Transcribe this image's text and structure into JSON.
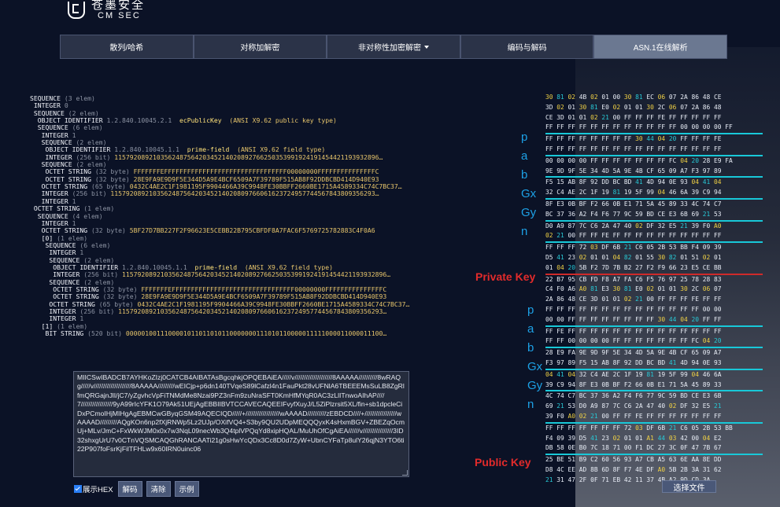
{
  "logo": {
    "cn": "苍墨安全",
    "en": "CM  SEC"
  },
  "nav": [
    {
      "label": "散列/哈希",
      "active": false
    },
    {
      "label": "对称加解密",
      "active": false
    },
    {
      "label": "非对称性加密解密",
      "active": false,
      "dropdown": true
    },
    {
      "label": "编码与解码",
      "active": false
    },
    {
      "label": "ASN.1在线解析",
      "active": true
    }
  ],
  "tree": [
    [
      [
        "k",
        "SEQUENCE"
      ],
      [
        "t",
        " (3 elem)"
      ]
    ],
    [
      [
        "k",
        " INTEGER"
      ],
      [
        "t",
        " 0"
      ]
    ],
    [
      [
        "k",
        " SEQUENCE"
      ],
      [
        "t",
        " (2 elem)"
      ]
    ],
    [
      [
        "k",
        "  OBJECT IDENTIFIER"
      ],
      [
        "t",
        " 1.2.840.10045.2.1"
      ],
      [
        "o",
        "  ecPublicKey"
      ],
      [
        "v",
        "  (ANSI X9.62 public key type)"
      ]
    ],
    [
      [
        "k",
        "  SEQUENCE"
      ],
      [
        "t",
        " (6 elem)"
      ]
    ],
    [
      [
        "k",
        "   INTEGER"
      ],
      [
        "t",
        " 1"
      ]
    ],
    [
      [
        "k",
        "   SEQUENCE"
      ],
      [
        "t",
        " (2 elem)"
      ]
    ],
    [
      [
        "k",
        "    OBJECT IDENTIFIER"
      ],
      [
        "t",
        " 1.2.840.10045.1.1"
      ],
      [
        "o",
        "  prime-field"
      ],
      [
        "v",
        "  (ANSI X9.62 field type)"
      ]
    ],
    [
      [
        "k",
        "    INTEGER"
      ],
      [
        "t",
        " (256 bit)"
      ],
      [
        "v",
        " 115792089210356248756420345214020892766250353991924191454421193932896…"
      ]
    ],
    [
      [
        "k",
        "   SEQUENCE"
      ],
      [
        "t",
        " (2 elem)"
      ]
    ],
    [
      [
        "k",
        "    OCTET STRING"
      ],
      [
        "t",
        " (32 byte)"
      ],
      [
        "v",
        " FFFFFFFEFFFFFFFFFFFFFFFFFFFFFFFFFFFFFFFF00000000FFFFFFFFFFFFFFFC"
      ]
    ],
    [
      [
        "k",
        "    OCTET STRING"
      ],
      [
        "t",
        " (32 byte)"
      ],
      [
        "v",
        " 28E9FA9E9D9F5E344D5A9E4BCF6509A7F39789F515AB8F92DDBCBD414D940E93"
      ]
    ],
    [
      [
        "k",
        "   OCTET STRING"
      ],
      [
        "t",
        " (65 byte)"
      ],
      [
        "v",
        " 0432C4AE2C1F1981195F9904466A39C9948FE30BBFF2660BE1715A4589334C74C7BC37…"
      ]
    ],
    [
      [
        "k",
        "   INTEGER"
      ],
      [
        "t",
        " (256 bit)"
      ],
      [
        "v",
        " 115792089210356248756420345214020809766061623724957744567843809356293…"
      ]
    ],
    [
      [
        "k",
        "   INTEGER"
      ],
      [
        "t",
        " 1"
      ]
    ],
    [
      [
        "k",
        " OCTET STRING"
      ],
      [
        "t",
        " (1 elem)"
      ]
    ],
    [
      [
        "k",
        "  SEQUENCE"
      ],
      [
        "t",
        " (4 elem)"
      ]
    ],
    [
      [
        "k",
        "   INTEGER"
      ],
      [
        "t",
        " 1"
      ]
    ],
    [
      [
        "k",
        "   OCTET STRING"
      ],
      [
        "t",
        " (32 byte)"
      ],
      [
        "v",
        " 5BF27D7BB227F2F96623E5CEBB22B795CBFDF8A7FAC6F5769725782883C4F0A6"
      ]
    ],
    [
      [
        "k",
        "   [0]"
      ],
      [
        "t",
        " (1 elem)"
      ]
    ],
    [
      [
        "k",
        "    SEQUENCE"
      ],
      [
        "t",
        " (6 elem)"
      ]
    ],
    [
      [
        "k",
        "     INTEGER"
      ],
      [
        "t",
        " 1"
      ]
    ],
    [
      [
        "k",
        "     SEQUENCE"
      ],
      [
        "t",
        " (2 elem)"
      ]
    ],
    [
      [
        "k",
        "      OBJECT IDENTIFIER"
      ],
      [
        "t",
        " 1.2.840.10045.1.1"
      ],
      [
        "o",
        "  prime-field"
      ],
      [
        "v",
        "  (ANSI X9.62 field type)"
      ]
    ],
    [
      [
        "k",
        "      INTEGER"
      ],
      [
        "t",
        " (256 bit)"
      ],
      [
        "v",
        " 115792089210356248756420345214020892766250353991924191454421193932896…"
      ]
    ],
    [
      [
        "k",
        "     SEQUENCE"
      ],
      [
        "t",
        " (2 elem)"
      ]
    ],
    [
      [
        "k",
        "      OCTET STRING"
      ],
      [
        "t",
        " (32 byte)"
      ],
      [
        "v",
        " FFFFFFFEFFFFFFFFFFFFFFFFFFFFFFFFFFFFFFFF00000000FFFFFFFFFFFFFFFC"
      ]
    ],
    [
      [
        "k",
        "      OCTET STRING"
      ],
      [
        "t",
        " (32 byte)"
      ],
      [
        "v",
        " 28E9FA9E9D9F5E344D5A9E4BCF6509A7F39789F515AB8F92DDBCBD414D940E93"
      ]
    ],
    [
      [
        "k",
        "     OCTET STRING"
      ],
      [
        "t",
        " (65 byte)"
      ],
      [
        "v",
        " 0432C4AE2C1F1981195F9904466A39C9948FE30BBFF2660BE1715A4589334C74C7BC37…"
      ]
    ],
    [
      [
        "k",
        "     INTEGER"
      ],
      [
        "t",
        " (256 bit)"
      ],
      [
        "v",
        " 115792089210356248756420345214020809766061623724957744567843809356293…"
      ]
    ],
    [
      [
        "k",
        "     INTEGER"
      ],
      [
        "t",
        " 1"
      ]
    ],
    [
      [
        "k",
        "   [1]"
      ],
      [
        "t",
        " (1 elem)"
      ]
    ],
    [
      [
        "k",
        "    BIT STRING"
      ],
      [
        "t",
        " (520 bit)"
      ],
      [
        "v",
        " 0000010011100001011011010110000000111010110000011111000011000011100…"
      ]
    ]
  ],
  "labels": {
    "params_top": [
      "p",
      "a",
      "b",
      "Gx",
      "Gy",
      "n"
    ],
    "params_bottom": [
      "p",
      "a",
      "b",
      "Gx",
      "Gy",
      "n"
    ],
    "private_key": "Private Key",
    "public_key": "Public Key"
  },
  "hex_lines": [
    "30 81 02 4B 02 01 00 30 81 EC 06 07 2A 86 48 CE",
    "3D 02 01 30 81 E0 02 01 01 30 2C 06 07 2A 86 48",
    "CE 3D 01 01 02 21 00 FF FF FF FE FF FF FF FF FF",
    "FF FF FF FF FF FF FF FF FF FF FF FF 00 00 00 00 FF",
    "FF FF FF FF FF FF FF FF 30 44 04 20 FF FF FF FE",
    "FF FF FF FF FF FF FF FF FF FF FF FF FF FF FF FF",
    "00 00 00 00 FF FF FF FF FF FF FF FC 04 20 28 E9 FA",
    "9E 9D 9F 5E 34 4D 5A 9E 4B CF 65 09 A7 F3 97 89",
    "F5 15 AB 8F 92 DD BC BD 41 4D 94 0E 93 04 41 04",
    "32 C4 AE 2C 1F 19 81 19 5F 99 04 46 6A 39 C9 94",
    "8F E3 0B BF F2 66 0B E1 71 5A 45 89 33 4C 74 C7",
    "BC 37 36 A2 F4 F6 77 9C 59 BD CE E3 6B 69 21 53",
    "D0 A9 87 7C C6 2A 47 40 02 DF 32 E5 21 39 F0 A0",
    "02 21 00 FF FF FE FF FF FF FF FF FF FF FF FF FF",
    "FF FF FF 72 03 DF 6B 21 C6 05 2B 53 BB F4 09 39",
    "D5 41 23 02 01 01 04 82 01 55 30 82 01 51 02 01",
    "01 04 20 5B F2 7D 7B B2 27 F2 F9 66 23 E5 CE BB",
    "22 B7 95 CB FD F8 A7 FA C6 F5 76 97 25 78 28 83",
    "C4 F0 A6 A0 81 E3 30 81 E0 02 01 01 30 2C 06 07",
    "2A 86 48 CE 3D 01 01 02 21 00 FF FF FF FE FF FF",
    "FF FF FF FF FF FF FF FF FF FF FF FF FF FF 00 00",
    "00 00 FF FF FF FF FF FF FF FF 30 44 04 20 FF FF",
    "FF FE FF FF FF FF FF FF FF FF FF FF FF FF FF FF",
    "FF FF 00 00 00 00 FF FF FF FF FF FF FF FC 04 20",
    "28 E9 FA 9E 9D 9F 5E 34 4D 5A 9E 4B CF 65 09 A7",
    "F3 97 89 F5 15 AB 8F 92 DD BC BD 41 4D 94 0E 93",
    "04 41 04 32 C4 AE 2C 1F 19 81 19 5F 99 04 46 6A",
    "39 C9 94 8F E3 0B BF F2 66 0B E1 71 5A 45 89 33",
    "4C 74 C7 BC 37 36 A2 F4 F6 77 9C 59 BD CE E3 6B",
    "69 21 53 D0 A9 87 7C C6 2A 47 40 02 DF 32 E5 21",
    "39 F0 A0 02 21 00 FF FF FE FF FF FF FF FF FF FF",
    "FF FF FF FF FF FF FF 72 03 DF 6B 21 C6 05 2B 53 BB",
    "F4 09 39 D5 41 23 02 01 01 A1 44 03 42 00 04 E2",
    "DB 58 0E B0 7C 18 71 00 F1 DC 27 3C 0F 47 7B 67",
    "25 BE 51 B9 C2 60 56 93 A7 CB A5 63 6E AA 8E DD",
    "D8 4C EE AD 8B 6D 8F F7 4E DF A0 5B 2B 3A 31 62",
    "21 31 47 2F 0F 71 EB 42 11 37 4B A2 9D CD 3A"
  ],
  "textarea": {
    "value": "MIICSwIBADCB7AYHKoZIzj0CATCB4AIBATAsBgcqhkjOPQEBAiEA/////v////////////////////8AAAAA//////////8wRAQg/////v////////////////////8AAAAA/////////wEICjp+p6dn140TVqeS89lCafzl4n1FauPkt28vUFNlA6TBEEEMsSuLB8ZgRlfmQRGajnJlI/jC7/yZgvhcVpFiTNMdMe8Nzai9PZ3nFm9zuNraSFT0KmHfMYqR0AC3zLlITnwoAIhAP////7/////////////////9yA99rIcYFK1O79Ak51UEjAgEBBIIBVTCCAVECAQEEIFvyfXuyJ/L5ZiPlzrsit5XL/fin+sb1dpcleCiDxPCmoIHjMIHgAgEBMCwGByqGSM49AQECIQD/////+//////////////////wAAAAD//////////zEBDCD////+/////////////////wAAAAD/////////AQgKOn6np2fXjRNWp5Lz2UJp/OXifVQ4+S3by9QU2UDpMEQQQyxK4sHxmBGV+ZBEZqOcmUj+MLv/JmC+FxWkWJM0x0x7w3NqL09necWb3Q4tplVPQqYd8xipHQAL/MuUhOfCgAiEA//////v////////////////3ID32shxgUrU7v0CTnVQSMCAQGhRANCAATi21g0sHwYcQDx3Cc8D0d7ZyW+UbnCYFaTp8ulY26qjN3YTO6ti22P907foFsrKjFilTFHLw9x60IRN0uinc06",
    "show_hex_label": "展示HEX",
    "show_hex_checked": true
  },
  "buttons": {
    "decode": "解码",
    "clear": "清除",
    "example": "示例",
    "choose_file": "选择文件"
  }
}
